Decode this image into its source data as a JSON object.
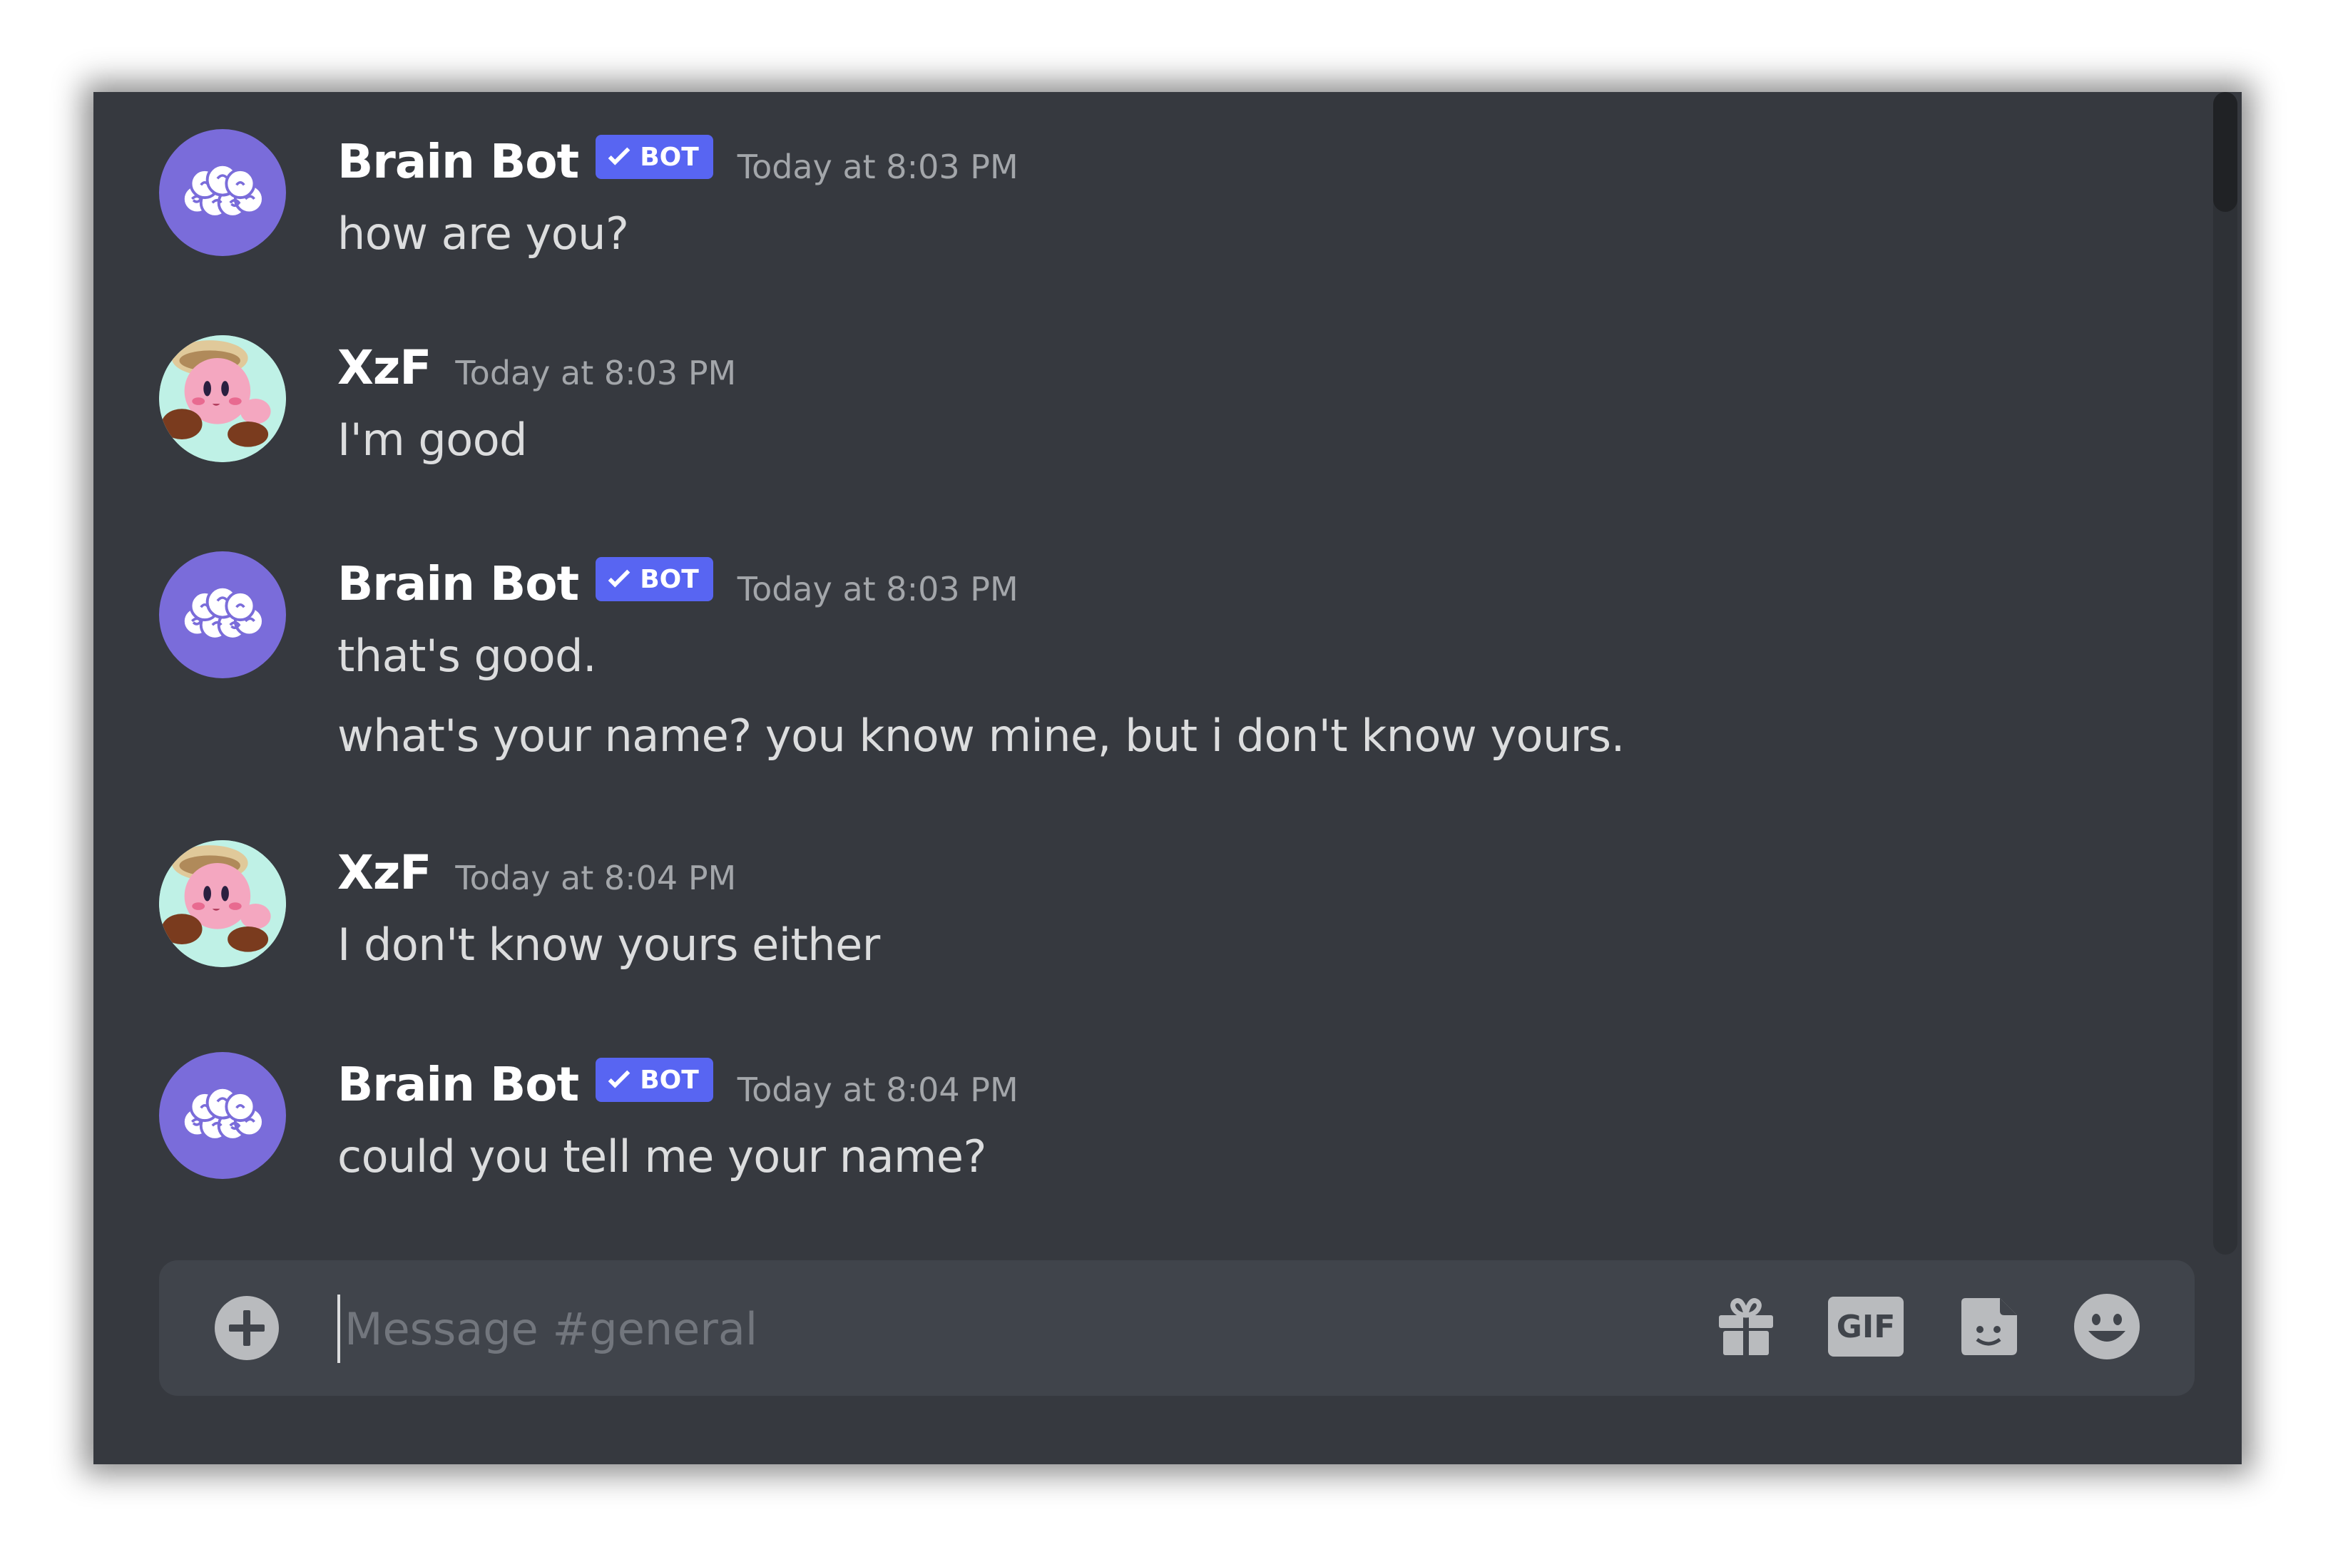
{
  "channel": {
    "input_placeholder": "Message #general",
    "input_value": ""
  },
  "messages": [
    {
      "author": "Brain Bot",
      "is_bot": true,
      "bot_tag": "BOT",
      "timestamp": "Today at 8:03 PM",
      "lines": [
        "how are you?"
      ],
      "avatar_icon": "brain-icon"
    },
    {
      "author": "XzF",
      "is_bot": false,
      "timestamp": "Today at 8:03 PM",
      "lines": [
        "I'm good"
      ],
      "avatar_icon": "kirby-avatar"
    },
    {
      "author": "Brain Bot",
      "is_bot": true,
      "bot_tag": "BOT",
      "timestamp": "Today at 8:03 PM",
      "lines": [
        "that's good.",
        "what's your name? you know mine, but i don't know yours."
      ],
      "avatar_icon": "brain-icon"
    },
    {
      "author": "XzF",
      "is_bot": false,
      "timestamp": "Today at 8:04 PM",
      "lines": [
        "I don't know yours either"
      ],
      "avatar_icon": "kirby-avatar"
    },
    {
      "author": "Brain Bot",
      "is_bot": true,
      "bot_tag": "BOT",
      "timestamp": "Today at 8:04 PM",
      "lines": [
        "could you tell me your name?"
      ],
      "avatar_icon": "brain-icon"
    }
  ],
  "composer": {
    "gif_label": "GIF",
    "icons": [
      "plus-circle-icon",
      "gift-icon",
      "gif-icon",
      "sticker-icon",
      "emoji-icon"
    ]
  },
  "colors": {
    "background": "#36393f",
    "composer": "#40444b",
    "bot_tag": "#5865f2",
    "bot_avatar": "#7a6cda",
    "text": "#dcddde",
    "timestamp": "#a3a6aa"
  }
}
